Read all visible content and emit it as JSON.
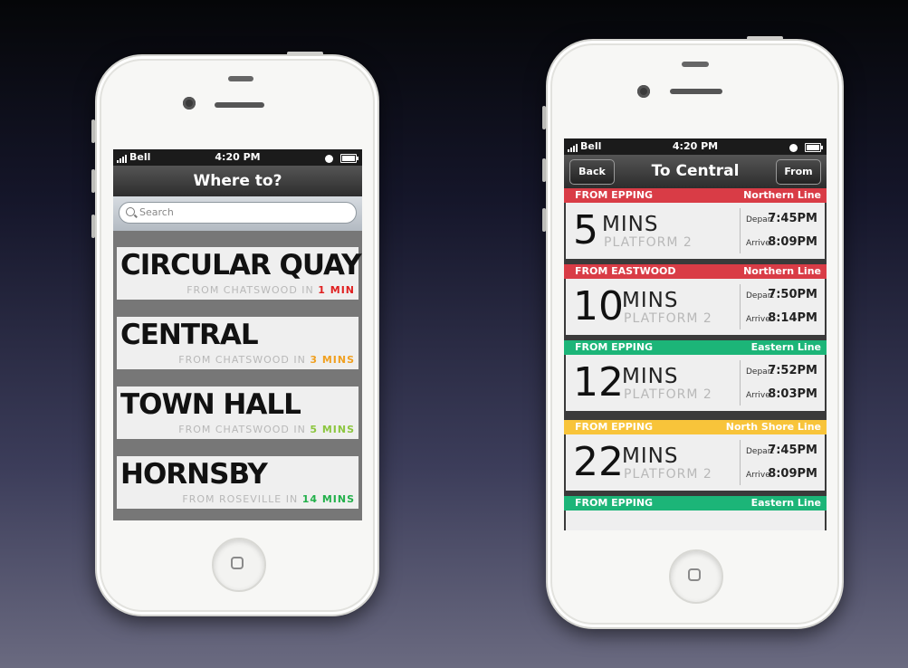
{
  "colors": {
    "red": "#d93c46",
    "green": "#1cb578",
    "yellow": "#f8c43a",
    "min_red": "#e02020",
    "min_orange": "#f0a020",
    "min_lime": "#8cc63f",
    "min_green": "#22b04a"
  },
  "left_phone": {
    "status": {
      "carrier": "Bell",
      "time": "4:20 PM"
    },
    "nav_title": "Where to?",
    "search": {
      "placeholder": "Search"
    },
    "destinations": [
      {
        "name": "CIRCULAR QUAY",
        "from_text": "FROM CHATSWOOD IN",
        "eta": "1 MIN",
        "eta_color": "min_red"
      },
      {
        "name": "CENTRAL",
        "from_text": "FROM CHATSWOOD IN",
        "eta": "3 MINS",
        "eta_color": "min_orange"
      },
      {
        "name": "TOWN HALL",
        "from_text": "FROM CHATSWOOD IN",
        "eta": "5 MINS",
        "eta_color": "min_lime"
      },
      {
        "name": "HORNSBY",
        "from_text": "FROM ROSEVILLE IN",
        "eta": "14 MINS",
        "eta_color": "min_green"
      }
    ]
  },
  "right_phone": {
    "status": {
      "carrier": "Bell",
      "time": "4:20 PM"
    },
    "nav_title": "To Central",
    "back_label": "Back",
    "from_label": "From",
    "depart_label": "Depart",
    "arrive_label": "Arrive",
    "trips": [
      {
        "from": "FROM EPPING",
        "line": "Northern Line",
        "color": "red",
        "minutes": "5",
        "mins_label": "MINS",
        "platform": "PLATFORM 2",
        "depart": "7:45PM",
        "arrive": "8:09PM"
      },
      {
        "from": "FROM EASTWOOD",
        "line": "Northern Line",
        "color": "red",
        "minutes": "10",
        "mins_label": "MINS",
        "platform": "PLATFORM 2",
        "depart": "7:50PM",
        "arrive": "8:14PM"
      },
      {
        "from": "FROM EPPING",
        "line": "Eastern Line",
        "color": "green",
        "minutes": "12",
        "mins_label": "MINS",
        "platform": "PLATFORM 2",
        "depart": "7:52PM",
        "arrive": "8:03PM"
      },
      {
        "from": "FROM EPPING",
        "line": "North Shore Line",
        "color": "yellow",
        "minutes": "22",
        "mins_label": "MINS",
        "platform": "PLATFORM 2",
        "depart": "7:45PM",
        "arrive": "8:09PM"
      }
    ],
    "partial_trip": {
      "from": "FROM EPPING",
      "line": "Eastern Line",
      "color": "green"
    }
  }
}
